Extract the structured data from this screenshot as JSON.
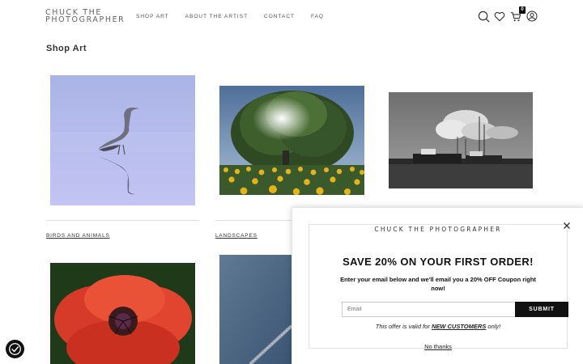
{
  "header": {
    "logo_line1": "CHUCK THE",
    "logo_line2": "PHOTOGRAPHER",
    "nav": [
      "SHOP ART",
      "ABOUT THE ARTIST",
      "CONTACT",
      "FAQ"
    ],
    "icons": [
      "search-icon",
      "heart-icon",
      "cart-icon",
      "account-icon"
    ],
    "cart_count": "0"
  },
  "page": {
    "title": "Shop Art"
  },
  "gallery": {
    "tiles": [
      {
        "label": "BIRDS AND ANIMALS",
        "image": "heron-photo"
      },
      {
        "label": "LANDSCAPES",
        "image": "sunflower-tree-photo"
      },
      {
        "label": "",
        "image": "harbor-boats-photo"
      },
      {
        "label": "",
        "image": "red-poppy-photo"
      },
      {
        "label": "",
        "image": "blue-abstract-photo"
      }
    ]
  },
  "popup": {
    "brand": "CHUCK THE PHOTOGRAPHER",
    "headline": "SAVE 20% ON YOUR FIRST ORDER!",
    "subtext": "Enter your email below and we'll email you a 20% OFF Coupon right now!",
    "email_placeholder": "Email",
    "submit_label": "SUBMIT",
    "offer_prefix": "This offer is valid for ",
    "offer_highlight": "NEW CUSTOMERS",
    "offer_suffix": " only!",
    "decline_label": "No thanks"
  },
  "colors": {
    "text": "#333333",
    "button": "#111111",
    "rule": "#dddddd"
  }
}
